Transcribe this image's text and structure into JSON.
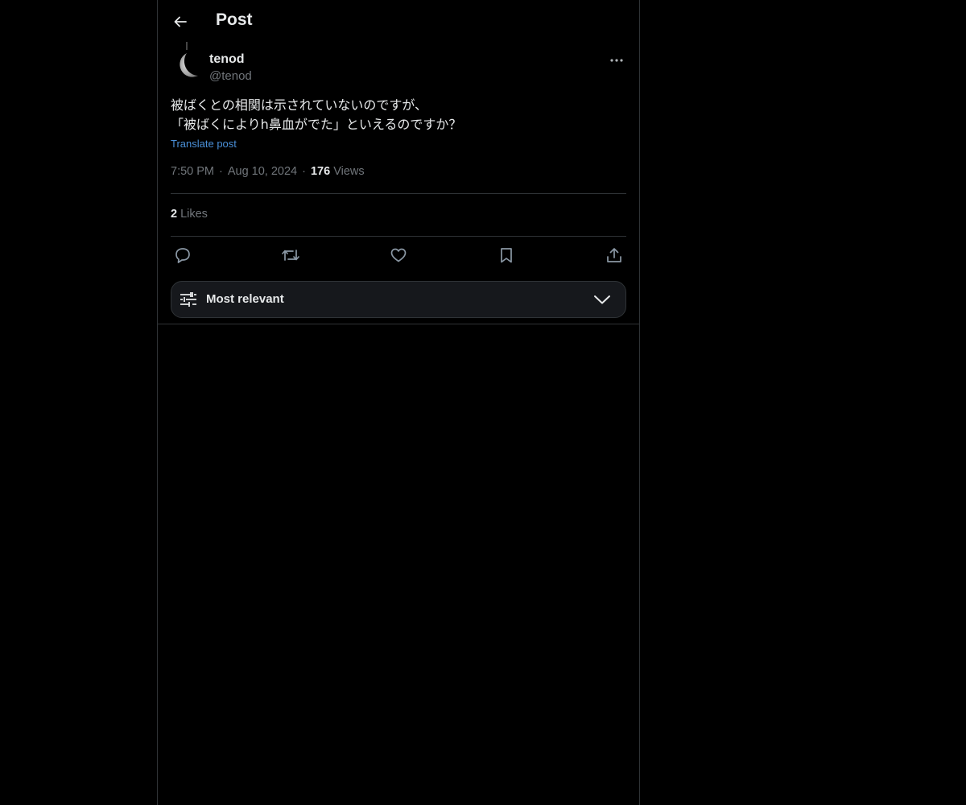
{
  "header": {
    "title": "Post",
    "back_icon": "arrow-left-icon"
  },
  "author": {
    "name": "tenod",
    "handle": "@tenod",
    "avatar": "moon-avatar",
    "more_icon": "ellipsis-icon"
  },
  "post": {
    "lines": [
      "被ばくとの相関は示されていないのですが、",
      "「被ばくによりh鼻血がでた」といえるのですか？"
    ],
    "translate_label": "Translate post",
    "time": "7:50 PM",
    "separator": "·",
    "date": "Aug 10, 2024",
    "views_count": "176",
    "views_label": "Views"
  },
  "stats": {
    "likes_count": "2",
    "likes_label": "Likes"
  },
  "actions": [
    {
      "icon": "reply-icon"
    },
    {
      "icon": "repost-icon"
    },
    {
      "icon": "like-icon"
    },
    {
      "icon": "bookmark-icon"
    },
    {
      "icon": "share-icon"
    }
  ],
  "sort": {
    "label": "Most relevant",
    "icon": "sliders-icon",
    "chevron": "chevron-down-icon"
  },
  "colors": {
    "background": "#000000",
    "text": "#e7e9ea",
    "muted": "#71767b",
    "border": "#2f3336",
    "link": "#4a90d9"
  }
}
